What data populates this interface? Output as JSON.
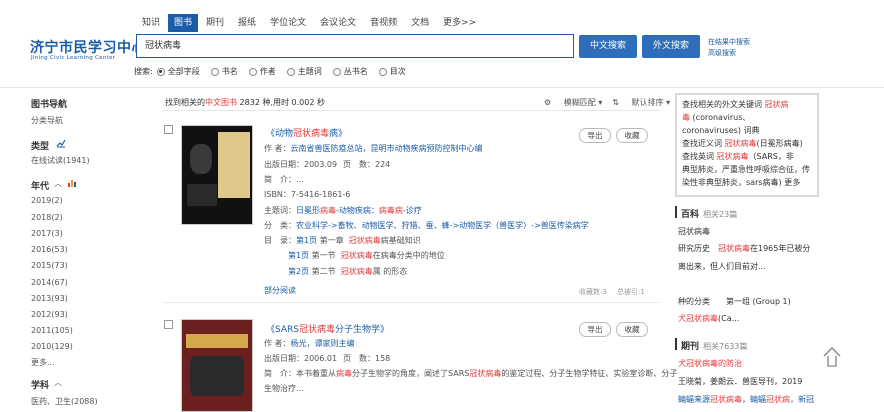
{
  "header": {
    "logo_title": "济宁市民学习中心",
    "logo_sub": "Jining Civic Learning Center",
    "tabs": [
      "知识",
      "图书",
      "期刊",
      "报纸",
      "学位论文",
      "会议论文",
      "音视频",
      "文档",
      "更多>>"
    ],
    "active_tab_index": 1,
    "search_value": "冠状病毒",
    "btn_zh": "中文搜索",
    "btn_en": "外文搜索",
    "btn_in_result": "在结果中搜索",
    "btn_advanced": "高级搜索",
    "scope_label": "搜索:",
    "scope_options": [
      "全部字段",
      "书名",
      "作者",
      "主题词",
      "丛书名",
      "目次"
    ],
    "scope_selected_index": 0
  },
  "sidebar": {
    "nav_title": "图书导航",
    "nav_item": "分类导航",
    "type_title": "类型",
    "type_item": "在线试读(1941)",
    "year_title": "年代",
    "years": [
      "2019(2)",
      "2018(2)",
      "2017(3)",
      "2016(53)",
      "2015(73)",
      "2014(67)",
      "2013(93)",
      "2012(93)",
      "2011(105)",
      "2010(129)"
    ],
    "more": "更多...",
    "subject_title": "学科",
    "subject_item": "医药、卫生(2088)"
  },
  "results": {
    "summary_prefix": "找到相关的",
    "summary_kind": "中文图书",
    "summary_suffix": " 2832 种,用时 0.002 秒",
    "sort_match": "模糊匹配",
    "sort_desc": "默认排序",
    "items": [
      {
        "title_pre": "《动物",
        "title_hl": "冠状病毒",
        "title_post": "病》",
        "author_label": "作 者：",
        "author": "云南省兽医防疫总站，昆明市动物疾病预防控制中心编",
        "date": "出版日期：2003.09",
        "pages": "页　数：224",
        "intro": "简　介：...",
        "isbn": "ISBN：7-5416-1861-6",
        "subject_label": "主题词：",
        "subject_pre": "日冕形",
        "subject_hl": "病毒",
        "subject_post": "-动物疾病：",
        "subject_hl2": "病毒病",
        "subject_post2": "-诊疗",
        "class_label": "分　类：",
        "class_value": "农业科学->畜牧、动物医学、狩猎、蚕、蜂->动物医学（兽医学）->兽医传染病学",
        "toc_label": "目　录：",
        "toc": [
          {
            "page": "第1页",
            "chap": "第一章",
            "hl": "冠状病毒",
            "rest": "病基础知识"
          },
          {
            "page": "第1页",
            "chap": "第一节",
            "hl": "冠状病毒",
            "rest": "在病毒分类中的地位"
          },
          {
            "page": "第2页",
            "chap": "第二节",
            "hl": "冠状病毒",
            "rest": "属 的形态"
          }
        ],
        "partial_read": "部分阅读",
        "export": "导出",
        "favorite": "收藏",
        "collect_count": "收藏数:3",
        "total_ref": "总被引:1"
      },
      {
        "title_pre": "《SARS",
        "title_hl": "冠状病毒",
        "title_post": "分子生物学》",
        "author_label": "作 者：",
        "author": "杨光，谭家则主编",
        "date": "出版日期：2006.01",
        "pages": "页　数：158",
        "intro_pre": "简　介：本书着重从",
        "intro_hl": "病毒",
        "intro_mid": "分子生物学的角度，阐述了SARS",
        "intro_hl2": "冠状病毒",
        "intro_post": "的鉴定过程、分子生物学特征、实验室诊断、分子",
        "intro_line2": "生物治疗...",
        "export": "导出",
        "favorite": "收藏"
      }
    ]
  },
  "right_panel": {
    "box_line1_pre": "查找相关的外文关键词 ",
    "box_line1_hl": "冠状病",
    "box_line2_hl": "毒",
    "box_line2_post": " (coronavirus、",
    "box_line3": "coronaviruses) 词典",
    "box_line4_pre": "查找近义词 ",
    "box_line4_hl": "冠状病毒",
    "box_line4_post": "(日冕形病毒)",
    "box_line5_pre": "查找英词 ",
    "box_line5_hl": "冠状病毒",
    "box_line5_post": "（SARS，非",
    "box_line6": "典型肺炎，严重急性呼吸综合征，传",
    "box_line7": "染性非典型肺炎，sars病毒) 更多",
    "baike_title": "百科",
    "baike_count": "相关23篇",
    "baike_item1_hl": "冠状病毒",
    "baike_line2_pre": "研究历史　",
    "baike_line2_hl": "冠状病毒",
    "baike_line2_post": "在1965年已被分",
    "baike_line3": "离出来，但人们目前对...",
    "baike_line4": "种的分类　　第一组 (Group 1)",
    "baike_line5_pre": "犬",
    "baike_line5_hl": "冠状病毒",
    "baike_line5_post": "(Ca...",
    "journal_title": "期刊",
    "journal_count": "相关7633篇",
    "journal_item1_pre": "犬",
    "journal_item1_hl": "冠状病毒",
    "journal_item1_post": "的防治",
    "journal_line2": "王晓菊，姜朗云．兽医导刊，2019",
    "journal_line3_pre": "蝙蝠来源",
    "journal_line3_hl": "冠状病毒",
    "journal_line3_mid": "，蝙蝠",
    "journal_line3_hl2": "冠状病",
    "journal_line3_post": "，新冠"
  }
}
